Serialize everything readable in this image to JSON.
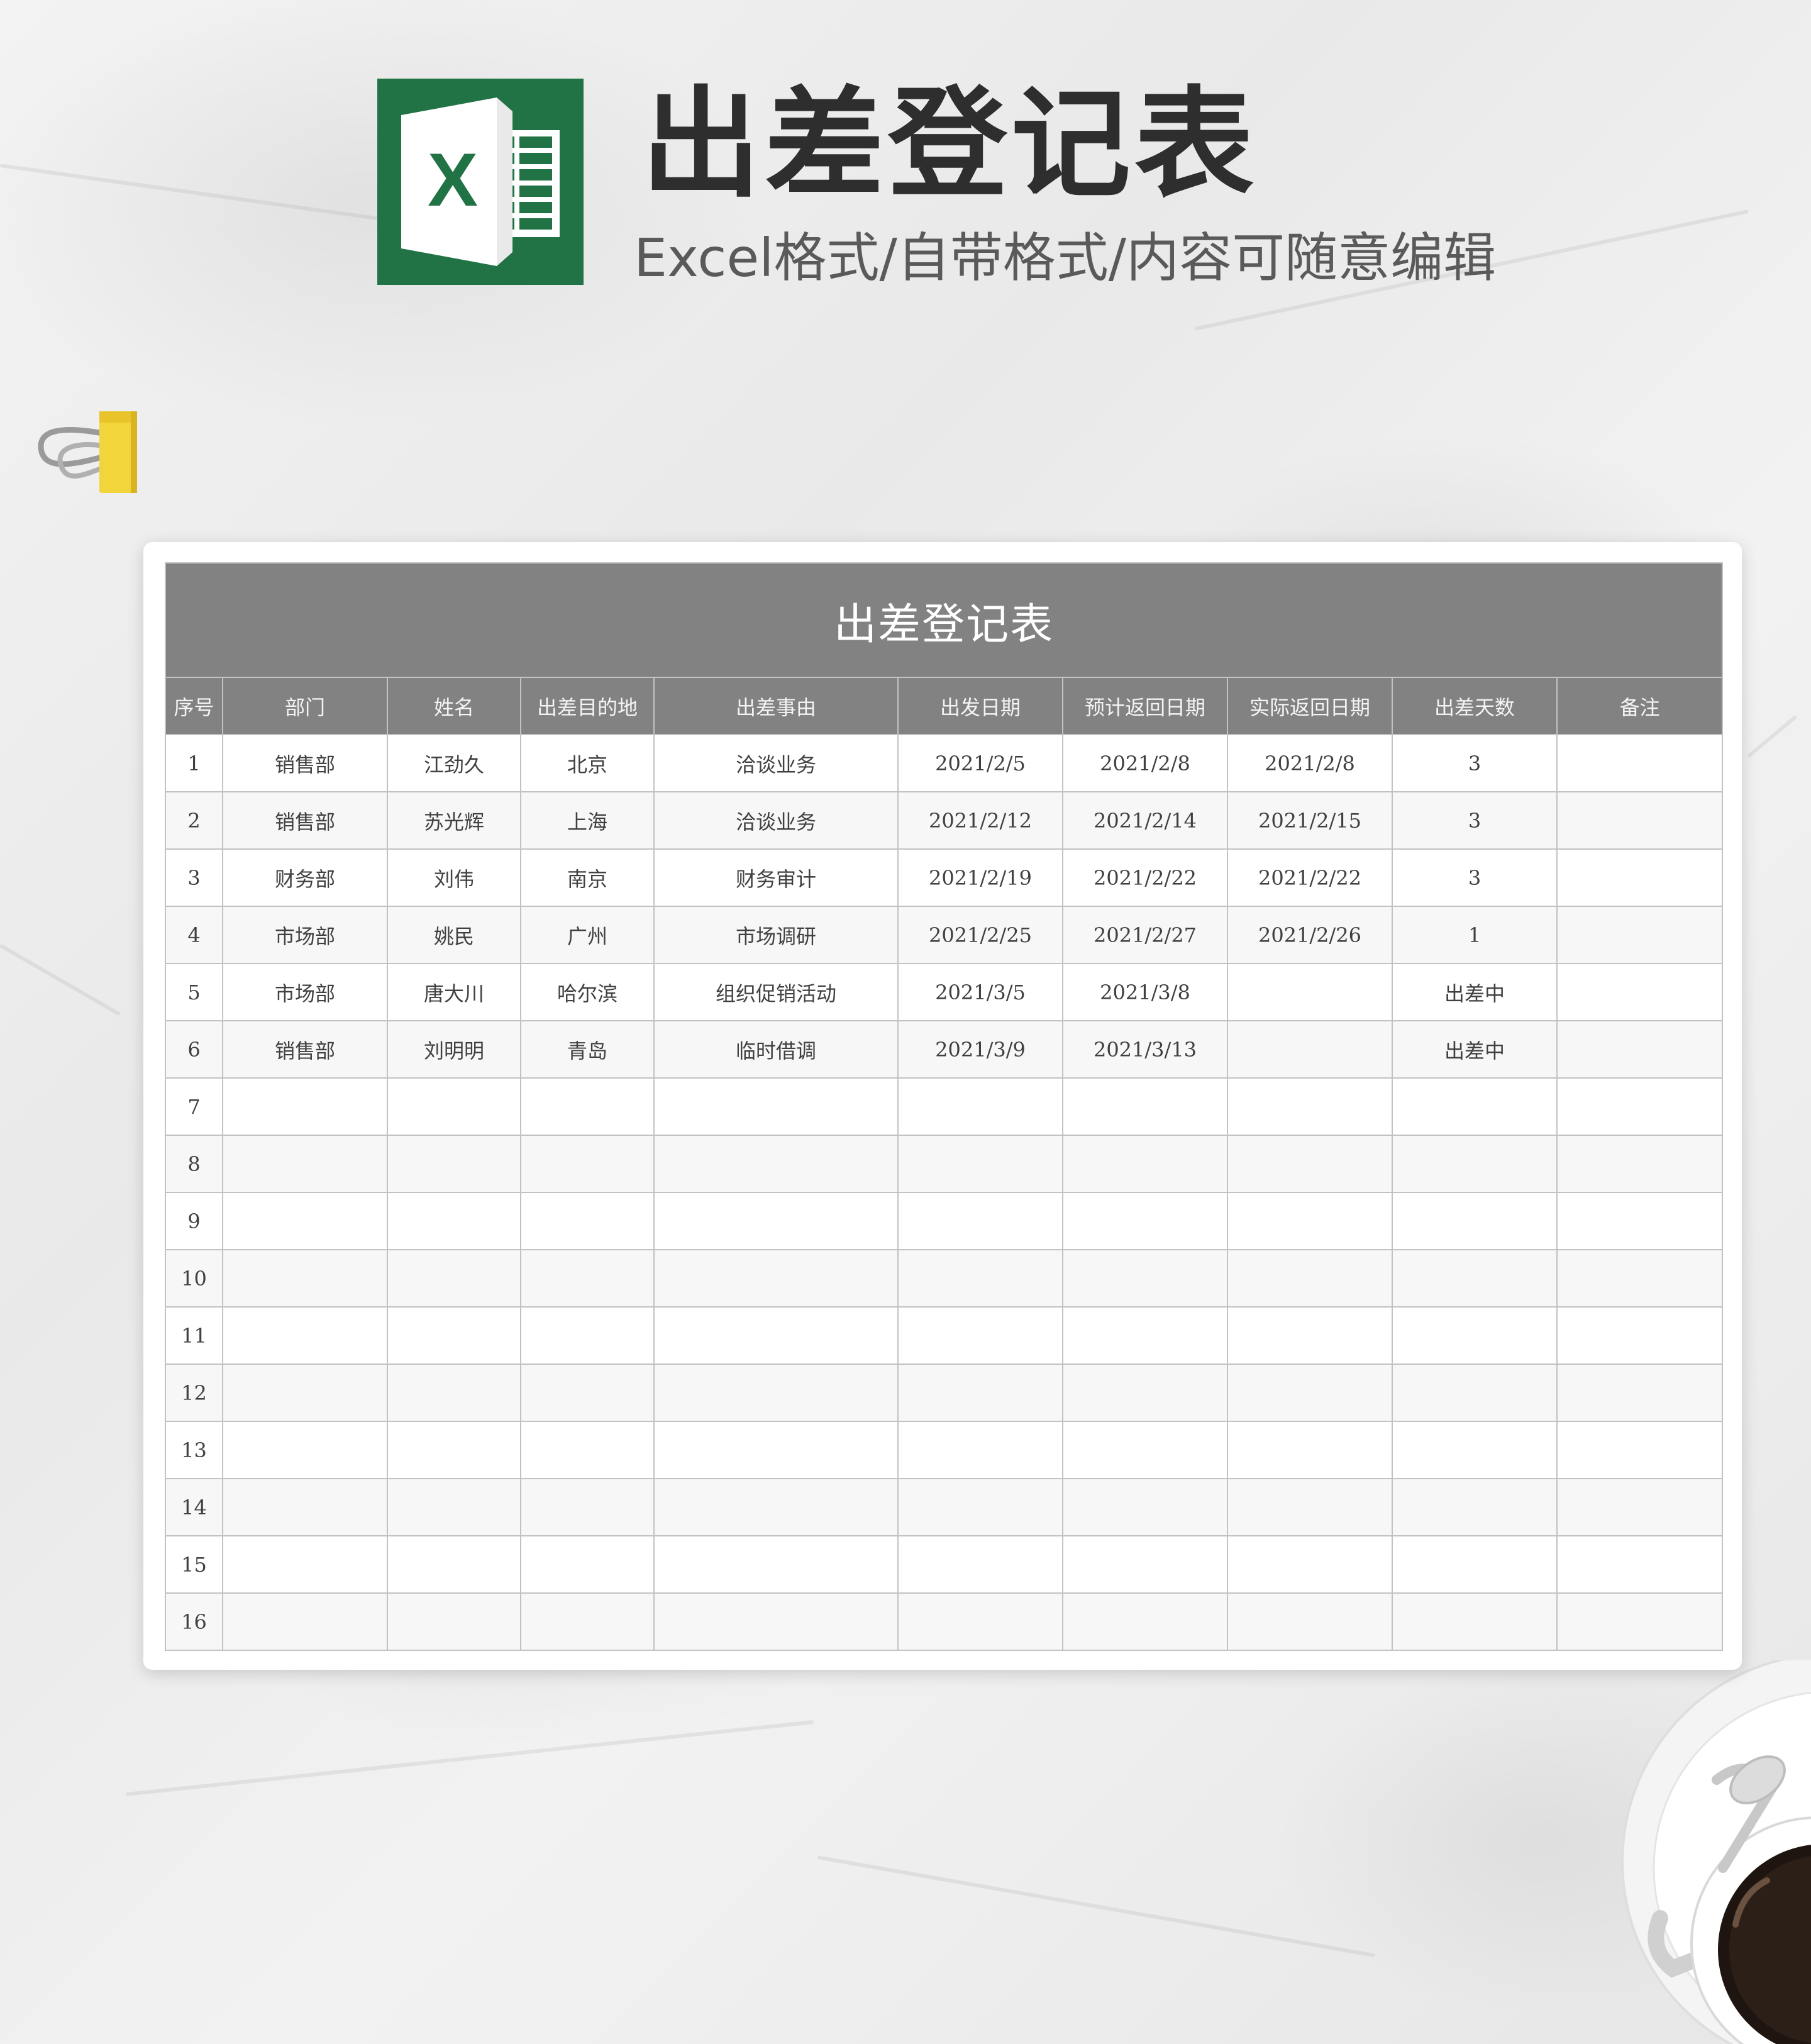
{
  "hero": {
    "title": "出差登记表",
    "subtitle": "Excel格式/自带格式/内容可随意编辑",
    "logo_letter": "X",
    "logo_color": "#217346"
  },
  "sheet": {
    "title": "出差登记表",
    "header_color": "#828282",
    "columns": [
      "序号",
      "部门",
      "姓名",
      "出差目的地",
      "出差事由",
      "出发日期",
      "预计返回日期",
      "实际返回日期",
      "出差天数",
      "备注"
    ],
    "rows": [
      [
        "1",
        "销售部",
        "江劲久",
        "北京",
        "洽谈业务",
        "2021/2/5",
        "2021/2/8",
        "2021/2/8",
        "3",
        ""
      ],
      [
        "2",
        "销售部",
        "苏光辉",
        "上海",
        "洽谈业务",
        "2021/2/12",
        "2021/2/14",
        "2021/2/15",
        "3",
        ""
      ],
      [
        "3",
        "财务部",
        "刘伟",
        "南京",
        "财务审计",
        "2021/2/19",
        "2021/2/22",
        "2021/2/22",
        "3",
        ""
      ],
      [
        "4",
        "市场部",
        "姚民",
        "广州",
        "市场调研",
        "2021/2/25",
        "2021/2/27",
        "2021/2/26",
        "1",
        ""
      ],
      [
        "5",
        "市场部",
        "唐大川",
        "哈尔滨",
        "组织促销活动",
        "2021/3/5",
        "2021/3/8",
        "",
        "出差中",
        ""
      ],
      [
        "6",
        "销售部",
        "刘明明",
        "青岛",
        "临时借调",
        "2021/3/9",
        "2021/3/13",
        "",
        "出差中",
        ""
      ],
      [
        "7",
        "",
        "",
        "",
        "",
        "",
        "",
        "",
        "",
        ""
      ],
      [
        "8",
        "",
        "",
        "",
        "",
        "",
        "",
        "",
        "",
        ""
      ],
      [
        "9",
        "",
        "",
        "",
        "",
        "",
        "",
        "",
        "",
        ""
      ],
      [
        "10",
        "",
        "",
        "",
        "",
        "",
        "",
        "",
        "",
        ""
      ],
      [
        "11",
        "",
        "",
        "",
        "",
        "",
        "",
        "",
        "",
        ""
      ],
      [
        "12",
        "",
        "",
        "",
        "",
        "",
        "",
        "",
        "",
        ""
      ],
      [
        "13",
        "",
        "",
        "",
        "",
        "",
        "",
        "",
        "",
        ""
      ],
      [
        "14",
        "",
        "",
        "",
        "",
        "",
        "",
        "",
        "",
        ""
      ],
      [
        "15",
        "",
        "",
        "",
        "",
        "",
        "",
        "",
        "",
        ""
      ],
      [
        "16",
        "",
        "",
        "",
        "",
        "",
        "",
        "",
        "",
        ""
      ]
    ]
  },
  "decor": {
    "binder_clip_color": "#f2d43b",
    "marble_color": "#ededed"
  }
}
